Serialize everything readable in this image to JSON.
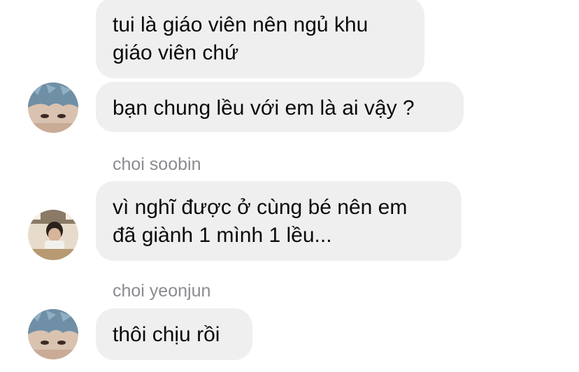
{
  "messages": [
    {
      "id": "m1",
      "text": "tui là giáo viên nên ngủ khu\ngiáo viên chứ"
    },
    {
      "id": "m2",
      "text": "bạn chung lều với em là ai vậy ?"
    },
    {
      "id": "m3",
      "sender": "choi soobin",
      "text": "vì nghĩ được ở cùng bé nên em\nđã giành 1 mình 1 lều..."
    },
    {
      "id": "m4",
      "sender": "choi yeonjun",
      "text": "thôi chịu rồi"
    }
  ],
  "colors": {
    "bubble_bg": "#efeff0",
    "sender_text": "#8b8b90",
    "message_text": "#0a0a0a",
    "avatar_blue_hair": "#6f8fa6"
  },
  "avatars": {
    "yeonjun": "avatar-blue-hair",
    "soobin": "avatar-photo-room"
  }
}
